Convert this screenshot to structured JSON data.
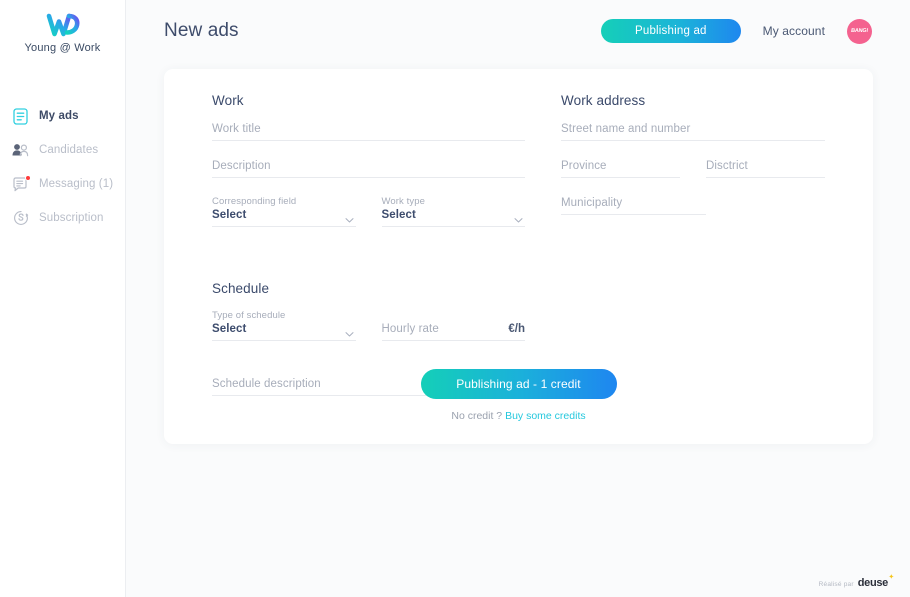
{
  "sidebar": {
    "brand_name": "Young @ Work",
    "brand_logo": "w-logo-icon",
    "items": [
      {
        "label": "My ads",
        "icon": "document-icon",
        "active": true,
        "badge": false
      },
      {
        "label": "Candidates",
        "icon": "users-icon",
        "active": false,
        "badge": false
      },
      {
        "label": "Messaging (1)",
        "icon": "message-icon",
        "active": false,
        "badge": true
      },
      {
        "label": "Subscription",
        "icon": "refresh-s-icon",
        "active": false,
        "badge": false
      }
    ]
  },
  "header": {
    "title": "New ads",
    "publish_button": "Publishing ad",
    "account_link": "My account",
    "avatar_text": "BANG!"
  },
  "form": {
    "work": {
      "section_title": "Work",
      "work_title_placeholder": "Work title",
      "work_title_value": "",
      "description_placeholder": "Description",
      "description_value": "",
      "corresponding_field_label": "Corresponding field",
      "corresponding_field_value": "Select",
      "work_type_label": "Work type",
      "work_type_value": "Select"
    },
    "schedule": {
      "section_title": "Schedule",
      "type_label": "Type of schedule",
      "type_value": "Select",
      "hourly_rate_placeholder": "Hourly rate",
      "hourly_rate_value": "",
      "hourly_rate_suffix": "€/h",
      "description_placeholder": "Schedule description",
      "description_value": ""
    },
    "address": {
      "section_title": "Work address",
      "street_placeholder": "Street name and number",
      "street_value": "",
      "province_placeholder": "Province",
      "province_value": "",
      "district_placeholder": "Disctrict",
      "district_value": "",
      "municipality_placeholder": "Municipality",
      "municipality_value": ""
    }
  },
  "submit": {
    "button_label": "Publishing ad - 1 credit",
    "credit_prefix": "No credit ?",
    "credit_link": "Buy some credits"
  },
  "footer": {
    "made_by": "Réalisé par",
    "brand": "deuse",
    "star": "✦"
  },
  "colors": {
    "gradient_start": "#14cfb8",
    "gradient_end": "#1e86f0",
    "accent_link": "#25c8dd",
    "avatar_bg": "#f4628f",
    "badge": "#ff3b3b",
    "text_dark": "#3d4c6d",
    "text_muted": "#a7adba"
  }
}
